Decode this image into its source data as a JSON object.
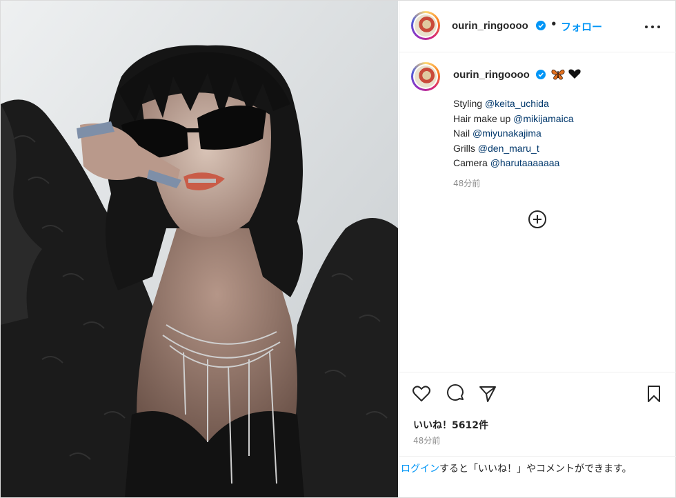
{
  "post": {
    "username": "ourin_ringoooo",
    "separator": "•",
    "follow_label": "フォロー",
    "more_icon": "more-options-icon"
  },
  "caption": {
    "username": "ourin_ringoooo",
    "emojis": [
      "butterfly",
      "black-heart"
    ],
    "lines": [
      {
        "label": "Styling",
        "mention": "@keita_uchida"
      },
      {
        "label": "Hair make up",
        "mention": "@mikijamaica"
      },
      {
        "label": "Nail",
        "mention": "@miyunakajima"
      },
      {
        "label": "Grills",
        "mention": "@den_maru_t"
      },
      {
        "label": "Camera",
        "mention": "@harutaaaaaaa"
      }
    ],
    "time": "48分前"
  },
  "actions": {
    "icons": [
      "heart-icon",
      "comment-icon",
      "share-icon",
      "bookmark-icon"
    ],
    "likes": "いいね！5612件",
    "time": "48分前"
  },
  "login_bar": {
    "link": "ログイン",
    "text": "すると「いいね！」やコメントができます。"
  },
  "colors": {
    "accent": "#0095f6",
    "mention": "#00376b",
    "muted": "#8e8e8e",
    "text": "#262626"
  }
}
